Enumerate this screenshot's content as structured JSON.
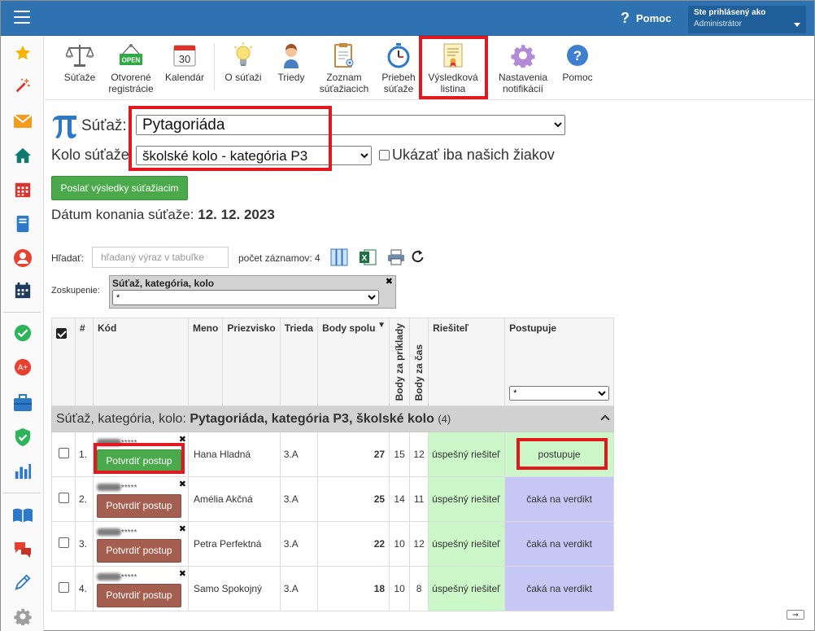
{
  "header": {
    "help_label": "Pomoc",
    "logged_in_label": "Ste prihlásený ako",
    "user_role": "Administrátor"
  },
  "sidebar": {
    "icons": [
      "star-icon",
      "magic-wand-icon",
      "mail-icon",
      "home-icon",
      "calendar-grid-icon",
      "notebook-icon",
      "person-icon",
      "schedule-icon",
      "check-circle-icon",
      "award-icon",
      "briefcase-icon",
      "shield-check-icon",
      "bar-chart-icon",
      "book-icon",
      "chat-icon",
      "pencil-icon",
      "gear-icon"
    ]
  },
  "toolbar": {
    "items": [
      {
        "label": "Súťaže",
        "icon": "scales-icon"
      },
      {
        "label": "Otvorené\nregistrácie",
        "icon": "open-sign-icon",
        "badge": "OPEN"
      },
      {
        "label": "Kalendár",
        "icon": "calendar-icon",
        "badge": "30"
      },
      {
        "label": "O súťaži",
        "icon": "lightbulb-icon"
      },
      {
        "label": "Triedy",
        "icon": "student-icon"
      },
      {
        "label": "Zoznam\nsúťažiacich",
        "icon": "clipboard-icon"
      },
      {
        "label": "Priebeh\nsúťaže",
        "icon": "stopwatch-icon"
      },
      {
        "label": "Výsledková\nlistina",
        "icon": "certificate-icon"
      },
      {
        "label": "Nastavenia\nnotifikácií",
        "icon": "settings-gear-icon"
      },
      {
        "label": "Pomoc",
        "icon": "help-icon"
      }
    ]
  },
  "form": {
    "competition_label": "Súťaž:",
    "competition_value": "Pytagoriáda",
    "round_label": "Kolo súťaže",
    "round_value": "školské kolo - kategória P3",
    "only_ours_label": "Ukázať iba našich žiakov",
    "send_results_button": "Poslať výsledky súťažiacim",
    "date_label": "Dátum konania súťaže:",
    "date_value": "12. 12. 2023"
  },
  "table_tools": {
    "search_label": "Hľadať:",
    "search_placeholder": "hľadaný výraz v tabuľke",
    "count_label": "počet záznamov: 4",
    "grouping_label": "Zoskupenie:",
    "grouping_chip": "Súťaž, kategória, kolo",
    "grouping_select": "*"
  },
  "table": {
    "headers": {
      "num": "#",
      "code": "Kód",
      "name": "Meno",
      "surname": "Priezvisko",
      "class": "Trieda",
      "total": "Body spolu",
      "pts_tasks": "Body za príklady",
      "pts_time": "Body za čas",
      "solver": "Riešiteľ",
      "advances": "Postupuje"
    },
    "filter_advances": "*",
    "group": {
      "prefix": "Súťaž, kategória, kolo: ",
      "title": "Pytagoriáda, kategória P3, školské kolo",
      "count": "(4)"
    },
    "rows": [
      {
        "num": "1.",
        "code_suffix": "*****",
        "button": "Potvrdiť postup",
        "name": "Hana Hladná",
        "class": "3.A",
        "total": "27",
        "tasks": "15",
        "time": "12",
        "solver": "úspešný riešiteľ",
        "advances": "postupuje"
      },
      {
        "num": "2.",
        "code_suffix": "*****",
        "button": "Potvrdiť postup",
        "name": "Amélia Akčná",
        "class": "3.A",
        "total": "25",
        "tasks": "14",
        "time": "11",
        "solver": "úspešný riešiteľ",
        "advances": "čaká na verdikt"
      },
      {
        "num": "3.",
        "code_suffix": "*****",
        "button": "Potvrdiť postup",
        "name": "Petra Perfektná",
        "class": "3.A",
        "total": "22",
        "tasks": "10",
        "time": "12",
        "solver": "úspešný riešiteľ",
        "advances": "čaká na verdikt"
      },
      {
        "num": "4.",
        "code_suffix": "*****",
        "button": "Potvrdiť postup",
        "name": "Samo Spokojný",
        "class": "3.A",
        "total": "18",
        "tasks": "10",
        "time": "8",
        "solver": "úspešný riešiteľ",
        "advances": "čaká na verdikt"
      }
    ]
  },
  "colors": {
    "header_blue": "#2f72b2",
    "highlight_red": "#e2181f",
    "success_green": "#4aa94a",
    "pending_brown": "#a55f50",
    "solver_bg": "#ccf7c8",
    "waiting_bg": "#c7c7f6"
  }
}
